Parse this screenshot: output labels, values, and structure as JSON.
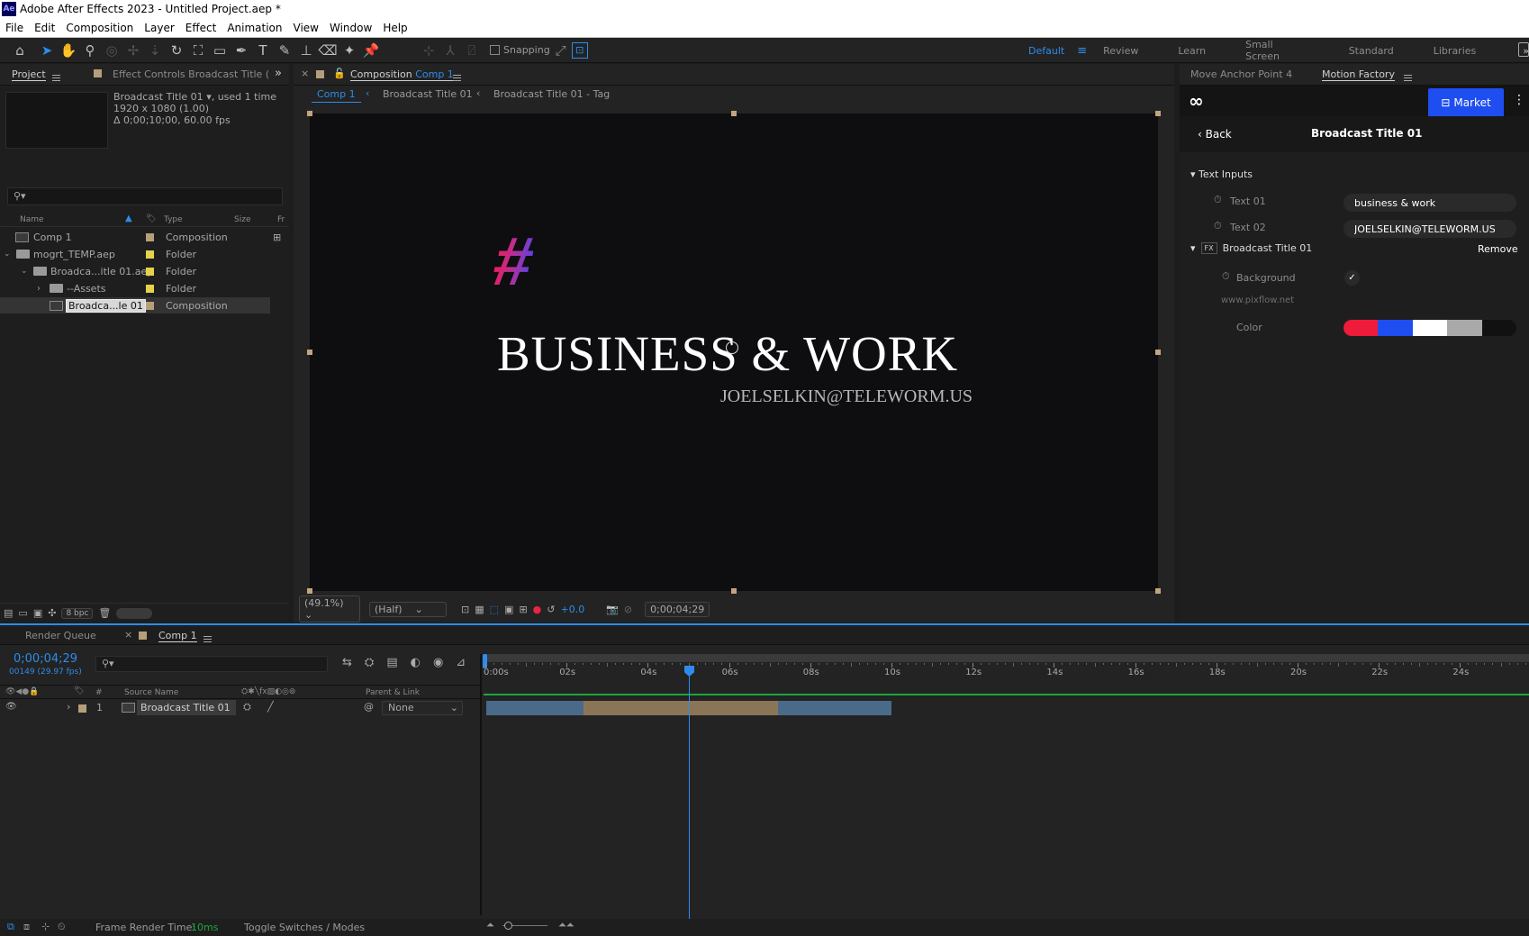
{
  "titlebar": {
    "logo": "Ae",
    "title": "Adobe After Effects 2023 - Untitled Project.aep *"
  },
  "menu": [
    "File",
    "Edit",
    "Composition",
    "Layer",
    "Effect",
    "Animation",
    "View",
    "Window",
    "Help"
  ],
  "toolbar": {
    "snapping_label": "Snapping"
  },
  "workspaces": {
    "active": "Default",
    "items": [
      "Review",
      "Learn",
      "Small Screen",
      "Standard",
      "Libraries"
    ]
  },
  "project": {
    "tab_project": "Project",
    "tab_effect_controls": "Effect Controls Broadcast Title (",
    "preview_name": "Broadcast Title 01",
    "preview_used": ", used 1 time",
    "preview_res": "1920 x 1080 (1.00)",
    "preview_dur": "Δ 0;00;10;00, 60.00 fps",
    "search_placeholder": "",
    "columns": {
      "name": "Name",
      "type": "Type",
      "size": "Size",
      "fr": "Fr"
    },
    "items": [
      {
        "name": "Comp 1",
        "type": "Composition"
      },
      {
        "name": "mogrt_TEMP.aep",
        "type": "Folder"
      },
      {
        "name": "Broadca...itle 01.aep",
        "type": "Folder"
      },
      {
        "name": "--Assets",
        "type": "Folder"
      },
      {
        "name": "Broadca...le 01",
        "type": "Composition"
      }
    ],
    "bpc": "8 bpc"
  },
  "comp": {
    "tab_label": "Composition",
    "tab_comp": "Comp 1",
    "breadcrumbs": [
      "Comp 1",
      "Broadcast Title 01",
      "Broadcast Title 01 - Tag"
    ],
    "headline": "BUSINESS & WORK",
    "subline": "JOELSELKIN@TELEWORM.US",
    "hash": "#",
    "zoom": "(49.1%)",
    "resolution": "(Half)",
    "exposure": "+0.0",
    "timecode": "0;00;04;29"
  },
  "motion_factory": {
    "tab_anchor": "Move Anchor Point 4",
    "tab_mf": "Motion Factory",
    "market_label": "Market",
    "back_label": "Back",
    "title": "Broadcast Title 01",
    "section_text_inputs": "Text Inputs",
    "text01_label": "Text 01",
    "text01_value": "business & work",
    "text02_label": "Text 02",
    "text02_value": "JOELSELKIN@TELEWORM.US",
    "fx_badge": "FX",
    "fx_name": "Broadcast Title 01",
    "remove_label": "Remove",
    "background_label": "Background",
    "credit": "www.pixflow.net",
    "color_label": "Color",
    "colors": [
      "#ee1b3a",
      "#1e4ef0",
      "#ffffff",
      "#a9a9a9",
      "#111111"
    ]
  },
  "timeline": {
    "tab_render_queue": "Render Queue",
    "tab_comp": "Comp 1",
    "timecode": "0;00;04;29",
    "frames": "00149 (29.97 fps)",
    "col_source": "Source Name",
    "col_hash": "#",
    "col_parent": "Parent & Link",
    "layer_num": "1",
    "layer_name": "Broadcast Title 01",
    "parent_value": "None",
    "ruler": [
      "0:00s",
      "02s",
      "04s",
      "06s",
      "08s",
      "10s",
      "12s",
      "14s",
      "16s",
      "18s",
      "20s",
      "22s",
      "24s"
    ],
    "frame_render_label": "Frame Render Time:",
    "frame_render_value": "10ms",
    "toggle_label": "Toggle Switches / Modes"
  }
}
